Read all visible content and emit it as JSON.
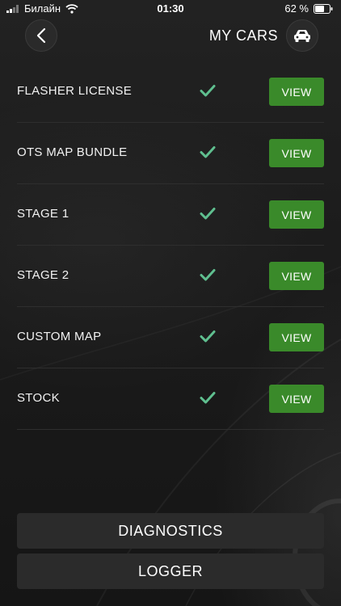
{
  "status_bar": {
    "carrier": "Билайн",
    "time": "01:30",
    "battery": "62 %"
  },
  "nav": {
    "title": "MY CARS",
    "back_icon": "chevron-left-icon",
    "car_icon": "car-icon"
  },
  "items": [
    {
      "label": "FLASHER LICENSE",
      "status": "check-icon",
      "button": "VIEW"
    },
    {
      "label": "OTS MAP BUNDLE",
      "status": "check-icon",
      "button": "VIEW"
    },
    {
      "label": "STAGE 1",
      "status": "check-icon",
      "button": "VIEW"
    },
    {
      "label": "STAGE 2",
      "status": "check-icon",
      "button": "VIEW"
    },
    {
      "label": "CUSTOM MAP",
      "status": "check-icon",
      "button": "VIEW"
    },
    {
      "label": "STOCK",
      "status": "check-icon",
      "button": "VIEW"
    }
  ],
  "actions": {
    "diagnostics": "DIAGNOSTICS",
    "logger": "LOGGER"
  },
  "colors": {
    "view_button": "#3a8a2a",
    "check": "#5fbf8f",
    "background": "#171717",
    "bottom_button": "#2b2b2b"
  }
}
